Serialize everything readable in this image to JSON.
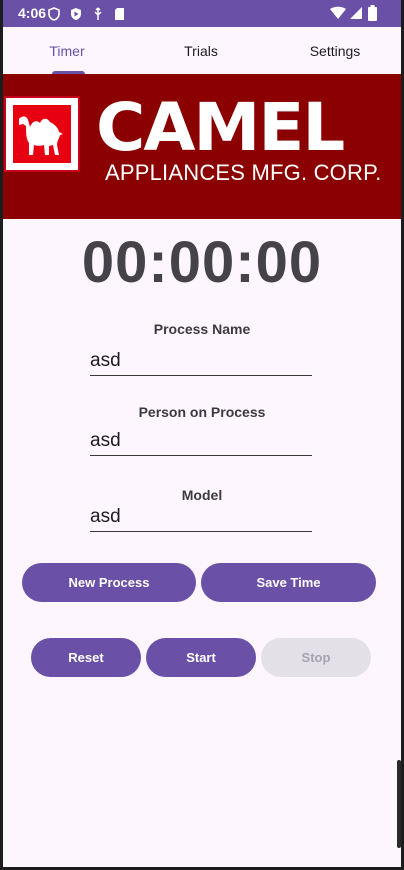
{
  "status_bar": {
    "time": "4:06",
    "icons_left": [
      "shield-icon",
      "play-protect-icon",
      "usb-icon",
      "sd-card-icon"
    ],
    "icons_right": [
      "wifi-icon",
      "signal-icon",
      "battery-icon"
    ]
  },
  "tabs": [
    {
      "label": "Timer",
      "active": true
    },
    {
      "label": "Trials",
      "active": false
    },
    {
      "label": "Settings",
      "active": false
    }
  ],
  "banner": {
    "brand": "CAMEL",
    "subtitle": "APPLIANCES MFG. CORP.",
    "logo_icon": "camel-icon"
  },
  "timer": {
    "display": "00:00:00"
  },
  "form": {
    "process_name": {
      "label": "Process Name",
      "value": "asd"
    },
    "person": {
      "label": "Person on Process",
      "value": "asd"
    },
    "model": {
      "label": "Model",
      "value": "asd"
    }
  },
  "actions": {
    "new_process": "New Process",
    "save_time": "Save Time",
    "reset": "Reset",
    "start": "Start",
    "stop": "Stop"
  },
  "colors": {
    "primary": "#6a50a7",
    "banner": "#8b0000",
    "logo_red": "#e60012",
    "background": "#fdf6ff"
  }
}
